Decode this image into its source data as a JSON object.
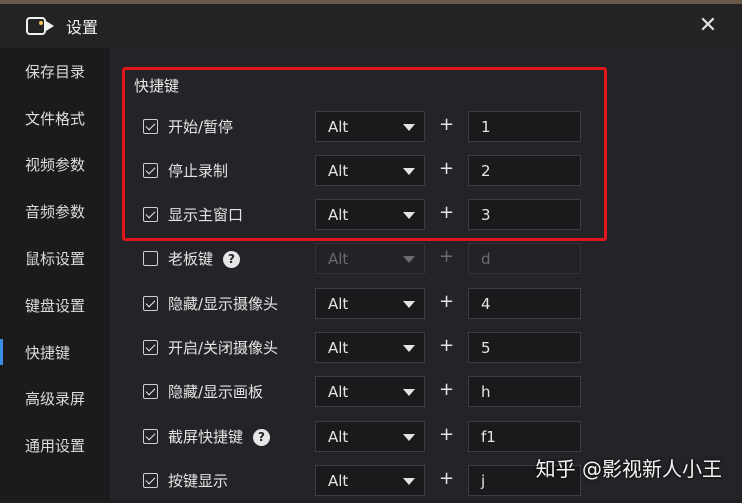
{
  "window": {
    "title": "设置",
    "close_glyph": "✕",
    "accent_color": "#3a8ee6",
    "highlight_color": "#e0161c"
  },
  "sidebar": {
    "items": [
      {
        "label": "保存目录",
        "active": false
      },
      {
        "label": "文件格式",
        "active": false
      },
      {
        "label": "视频参数",
        "active": false
      },
      {
        "label": "音频参数",
        "active": false
      },
      {
        "label": "鼠标设置",
        "active": false
      },
      {
        "label": "键盘设置",
        "active": false
      },
      {
        "label": "快捷键",
        "active": true
      },
      {
        "label": "高级录屏",
        "active": false
      },
      {
        "label": "通用设置",
        "active": false
      }
    ]
  },
  "main": {
    "section_title": "快捷键",
    "plus_sign": "+",
    "help_glyph": "?",
    "shortcuts": [
      {
        "label": "开始/暂停",
        "checked": true,
        "modifier": "Alt",
        "key": "1",
        "help": false,
        "disabled": false
      },
      {
        "label": "停止录制",
        "checked": true,
        "modifier": "Alt",
        "key": "2",
        "help": false,
        "disabled": false
      },
      {
        "label": "显示主窗口",
        "checked": true,
        "modifier": "Alt",
        "key": "3",
        "help": false,
        "disabled": false
      },
      {
        "label": "老板键",
        "checked": false,
        "modifier": "Alt",
        "key": "d",
        "help": true,
        "disabled": true
      },
      {
        "label": "隐藏/显示摄像头",
        "checked": true,
        "modifier": "Alt",
        "key": "4",
        "help": false,
        "disabled": false
      },
      {
        "label": "开启/关闭摄像头",
        "checked": true,
        "modifier": "Alt",
        "key": "5",
        "help": false,
        "disabled": false
      },
      {
        "label": "隐藏/显示画板",
        "checked": true,
        "modifier": "Alt",
        "key": "h",
        "help": false,
        "disabled": false
      },
      {
        "label": "截屏快捷键",
        "checked": true,
        "modifier": "Alt",
        "key": "f1",
        "help": true,
        "disabled": false
      },
      {
        "label": "按键显示",
        "checked": true,
        "modifier": "Alt",
        "key": "j",
        "help": false,
        "disabled": false
      }
    ]
  },
  "watermark": {
    "text": "知乎 @影视新人小王"
  }
}
